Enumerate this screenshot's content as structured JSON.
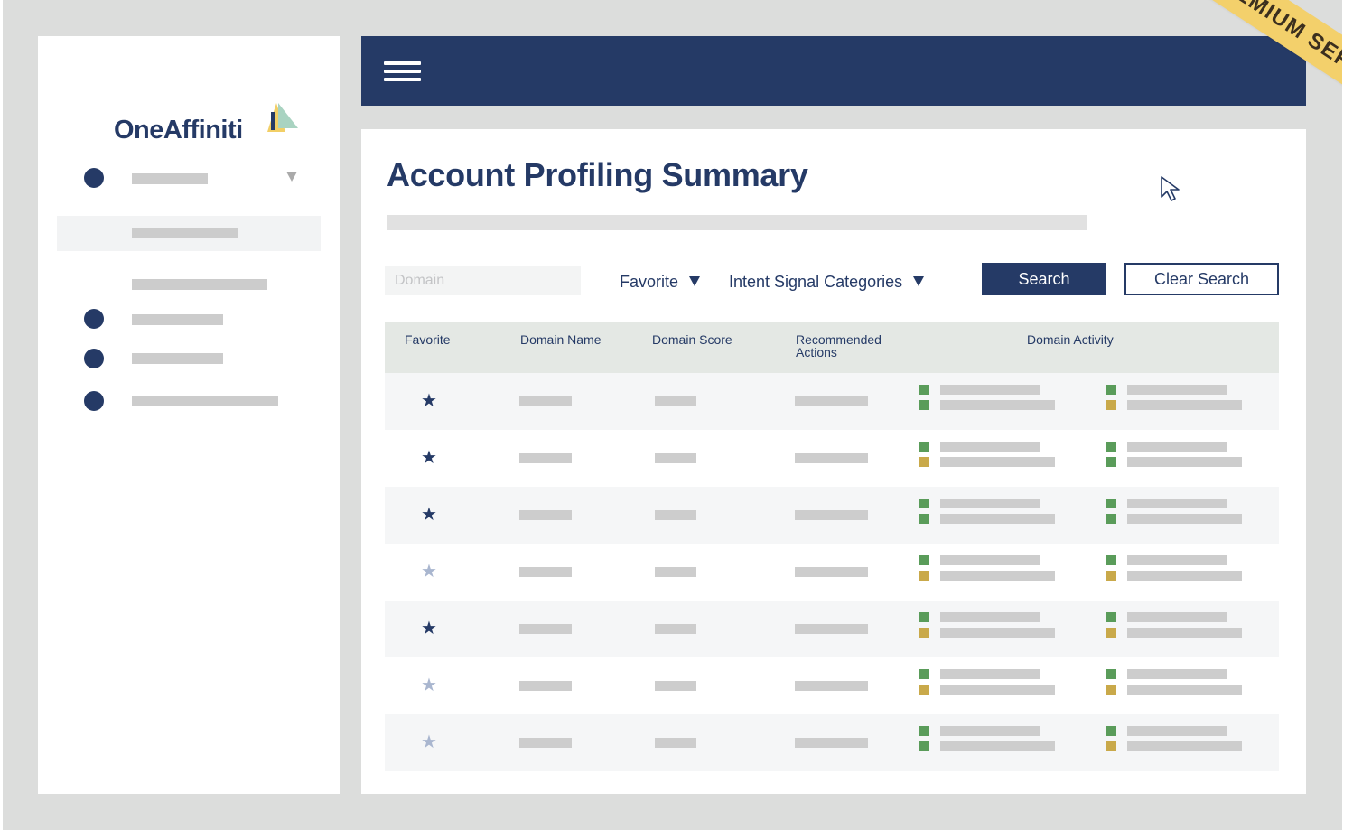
{
  "app": {
    "brand": "OneAffiniti"
  },
  "banner": {
    "label": "PREMIUM SERVICE",
    "color": "#f3d06b"
  },
  "page": {
    "title": "Account Profiling Summary"
  },
  "filters": {
    "domain_placeholder": "Domain",
    "favorite_label": "Favorite",
    "intent_label": "Intent Signal Categories",
    "search_label": "Search",
    "clear_label": "Clear Search"
  },
  "table": {
    "columns": [
      "Favorite",
      "Domain Name",
      "Domain Score",
      "Recommended Actions",
      "Domain Activity"
    ],
    "rows": [
      {
        "favorite": true,
        "activity_left": [
          "green",
          "green"
        ],
        "activity_right": [
          "green",
          "gold"
        ]
      },
      {
        "favorite": true,
        "activity_left": [
          "green",
          "gold"
        ],
        "activity_right": [
          "green",
          "green"
        ]
      },
      {
        "favorite": true,
        "activity_left": [
          "green",
          "green"
        ],
        "activity_right": [
          "green",
          "green"
        ]
      },
      {
        "favorite": false,
        "activity_left": [
          "green",
          "gold"
        ],
        "activity_right": [
          "green",
          "gold"
        ]
      },
      {
        "favorite": true,
        "activity_left": [
          "green",
          "gold"
        ],
        "activity_right": [
          "green",
          "gold"
        ]
      },
      {
        "favorite": false,
        "activity_left": [
          "green",
          "gold"
        ],
        "activity_right": [
          "green",
          "gold"
        ]
      },
      {
        "favorite": false,
        "activity_left": [
          "green",
          "green"
        ],
        "activity_right": [
          "green",
          "gold"
        ]
      }
    ]
  },
  "colors": {
    "brand_navy": "#253a66",
    "activity_green": "#5a9c5a",
    "activity_gold": "#c9a94a",
    "star_filled": "#253a66",
    "star_empty": "#a9b6cf"
  },
  "icons": {
    "star": "★",
    "menu": "hamburger-icon",
    "cursor": "arrow-cursor-icon"
  }
}
